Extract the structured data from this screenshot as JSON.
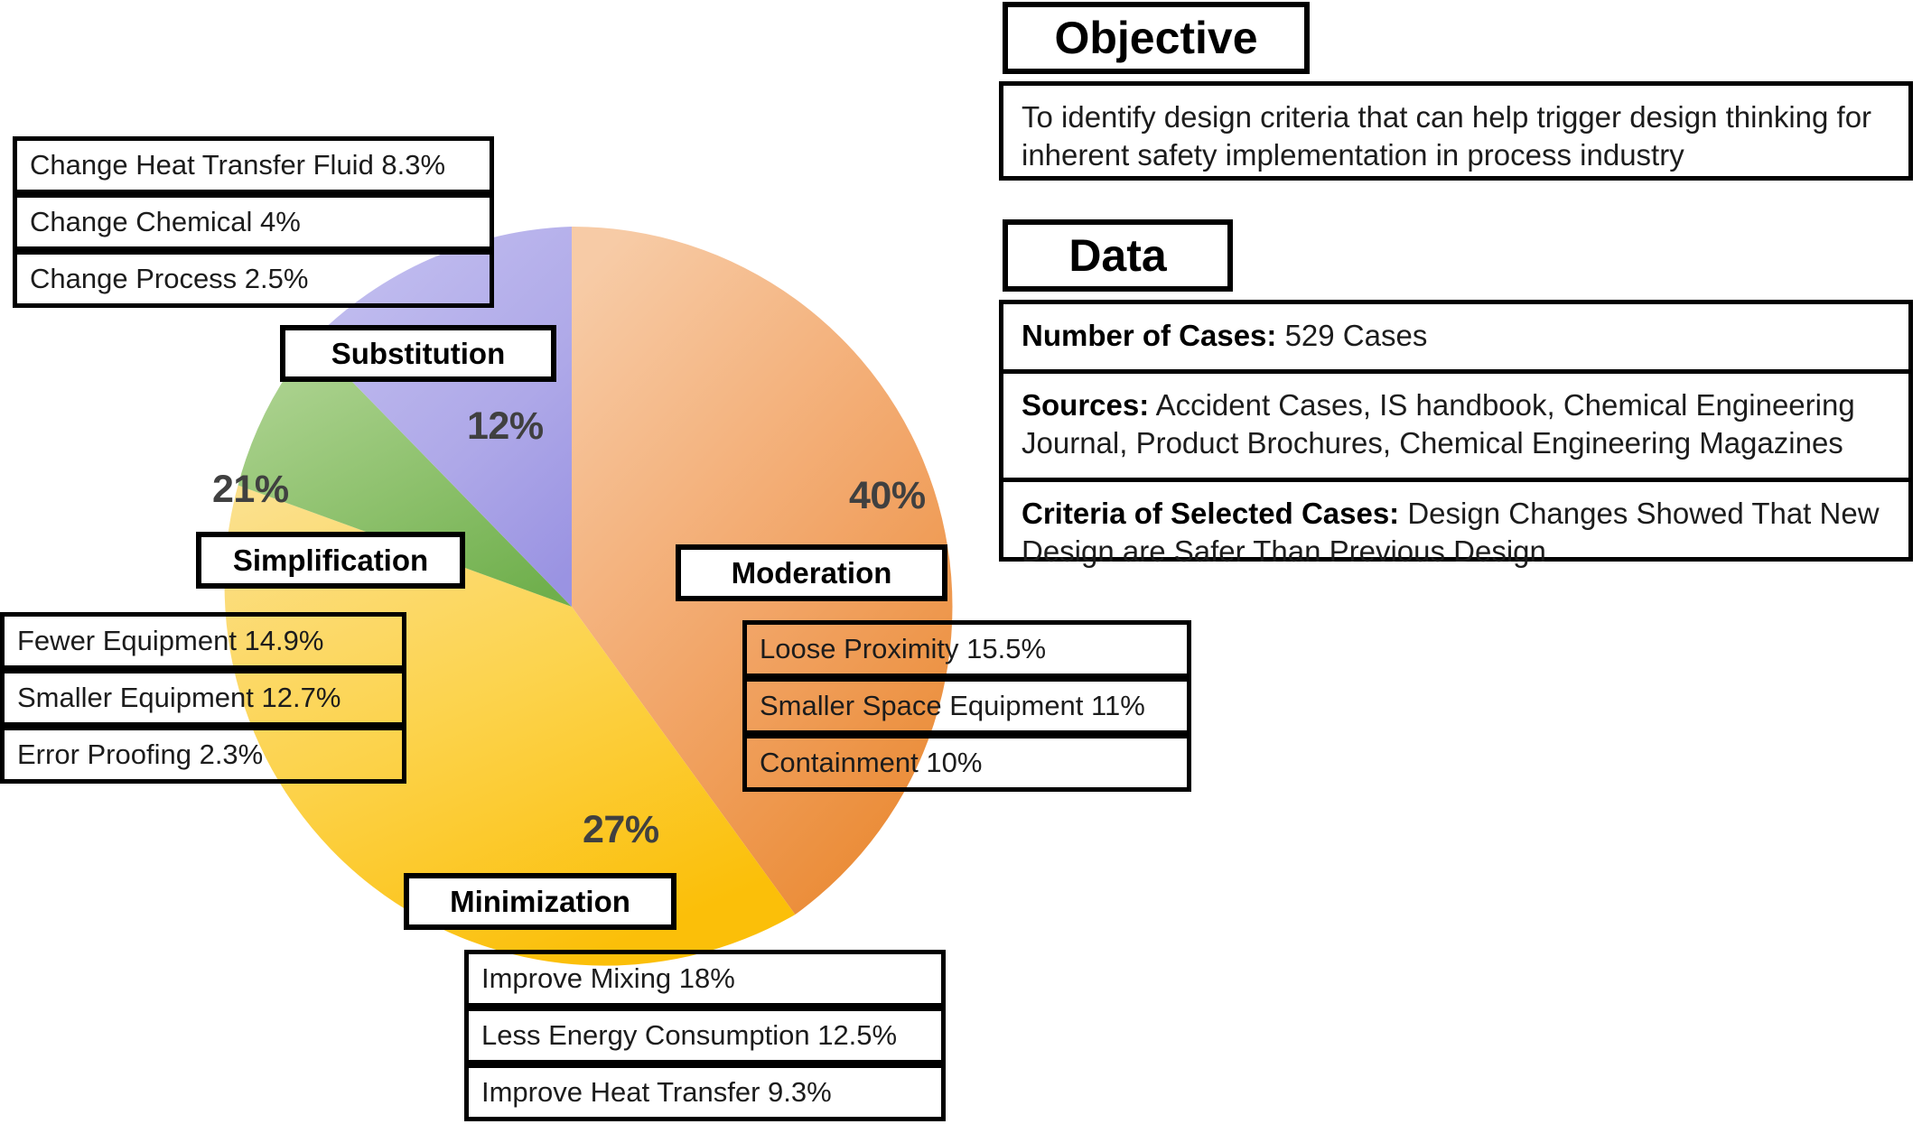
{
  "chart_data": {
    "type": "pie",
    "title": "",
    "categories": [
      "Moderation",
      "Minimization",
      "Simplification",
      "Substitution"
    ],
    "values": [
      40,
      27,
      21,
      12
    ],
    "unit": "%",
    "labels": [
      "40%",
      "27%",
      "21%",
      "12%"
    ],
    "colors": [
      "#F0A666",
      "#FBC72C",
      "#8CC06B",
      "#A9A4E8"
    ],
    "start_angle_deg": 0,
    "direction": "clockwise",
    "legend": "none",
    "grid": false,
    "sub_items": {
      "Moderation": [
        {
          "label": "Loose Proximity 15.5%",
          "value": 15.5
        },
        {
          "label": "Smaller Space Equipment 11%",
          "value": 11
        },
        {
          "label": "Containment 10%",
          "value": 10
        }
      ],
      "Minimization": [
        {
          "label": "Improve Mixing 18%",
          "value": 18
        },
        {
          "label": "Less Energy Consumption 12.5%",
          "value": 12.5
        },
        {
          "label": "Improve Heat Transfer 9.3%",
          "value": 9.3
        }
      ],
      "Simplification": [
        {
          "label": "Fewer Equipment 14.9%",
          "value": 14.9
        },
        {
          "label": "Smaller Equipment 12.7%",
          "value": 12.7
        },
        {
          "label": "Error Proofing 2.3%",
          "value": 2.3
        }
      ],
      "Substitution": [
        {
          "label": "Change Heat Transfer Fluid 8.3%",
          "value": 8.3
        },
        {
          "label": "Change Chemical 4%",
          "value": 4
        },
        {
          "label": "Change Process 2.5%",
          "value": 2.5
        }
      ]
    }
  },
  "pie": {
    "slices": {
      "moderation": {
        "name": "Moderation",
        "pct": "40%"
      },
      "minimization": {
        "name": "Minimization",
        "pct": "27%"
      },
      "simplification": {
        "name": "Simplification",
        "pct": "21%"
      },
      "substitution": {
        "name": "Substitution",
        "pct": "12%"
      }
    }
  },
  "substitution_items": {
    "item1": "Change Heat Transfer Fluid 8.3%",
    "item2": "Change Chemical 4%",
    "item3": "Change Process 2.5%"
  },
  "simplification_items": {
    "item1": "Fewer Equipment 14.9%",
    "item2": "Smaller Equipment 12.7%",
    "item3": "Error Proofing 2.3%"
  },
  "minimization_items": {
    "item1": "Improve Mixing 18%",
    "item2": "Less Energy Consumption 12.5%",
    "item3": "Improve Heat Transfer 9.3%"
  },
  "moderation_items": {
    "item1": "Loose Proximity 15.5%",
    "item2": "Smaller Space Equipment 11%",
    "item3": "Containment 10%"
  },
  "objective": {
    "heading": "Objective",
    "text": "To identify design criteria that can help trigger design thinking for inherent safety implementation in process industry"
  },
  "data_panel": {
    "heading": "Data",
    "rows": [
      {
        "label": "Number of Cases:",
        "value": " 529 Cases"
      },
      {
        "label": "Sources:",
        "value": " Accident Cases, IS handbook, Chemical Engineering Journal, Product Brochures, Chemical Engineering Magazines"
      },
      {
        "label": "Criteria of Selected Cases:",
        "value": " Design Changes Showed That New Design are Safer Than Previous Design"
      }
    ]
  }
}
